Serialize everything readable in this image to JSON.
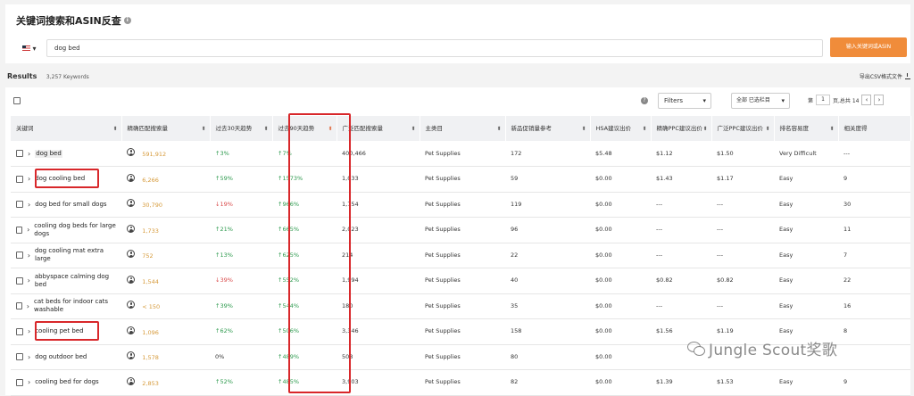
{
  "header": {
    "title": "关键词搜索和ASIN反查",
    "search_value": "dog bed",
    "search_button": "输入关键词或ASIN"
  },
  "results": {
    "label": "Results",
    "count": "3,257 Keywords",
    "export": "导出CSV格式文件"
  },
  "toolbar": {
    "filters": "Filters",
    "column_select": "全部 已选栏目",
    "page_prefix": "第",
    "page_value": "1",
    "page_suffix": "页,总共 14"
  },
  "columns": [
    "关键词",
    "精确匹配搜索量",
    "过去30天趋势",
    "过去90天趋势",
    "广泛匹配搜索量",
    "主类目",
    "新品促销量参考",
    "HSA建议出价",
    "精确PPC建议出价",
    "广泛PPC建议出价",
    "排名容易度",
    "相关度得"
  ],
  "rows": [
    {
      "keyword": "dog bed",
      "exact": "591,912",
      "t30": "3%",
      "t30dir": "up",
      "t90": "7%",
      "broad": "400,466",
      "category": "Pet Supplies",
      "promo": "172",
      "hsa": "$5.48",
      "exact_ppc": "$1.12",
      "broad_ppc": "$1.50",
      "ease": "Very Difficult",
      "rel": "---"
    },
    {
      "keyword": "dog cooling bed",
      "exact": "6,266",
      "t30": "59%",
      "t30dir": "up",
      "t90": "1573%",
      "broad": "1,033",
      "category": "Pet Supplies",
      "promo": "59",
      "hsa": "$0.00",
      "exact_ppc": "$1.43",
      "broad_ppc": "$1.17",
      "ease": "Easy",
      "rel": "9"
    },
    {
      "keyword": "dog bed for small dogs",
      "exact": "30,790",
      "t30": "19%",
      "t30dir": "down",
      "t90": "966%",
      "broad": "1,754",
      "category": "Pet Supplies",
      "promo": "119",
      "hsa": "$0.00",
      "exact_ppc": "---",
      "broad_ppc": "---",
      "ease": "Easy",
      "rel": "30"
    },
    {
      "keyword": "cooling dog beds for large dogs",
      "exact": "1,733",
      "t30": "21%",
      "t30dir": "up",
      "t90": "665%",
      "broad": "2,023",
      "category": "Pet Supplies",
      "promo": "96",
      "hsa": "$0.00",
      "exact_ppc": "---",
      "broad_ppc": "---",
      "ease": "Easy",
      "rel": "11"
    },
    {
      "keyword": "dog cooling mat extra large",
      "exact": "752",
      "t30": "13%",
      "t30dir": "up",
      "t90": "625%",
      "broad": "214",
      "category": "Pet Supplies",
      "promo": "22",
      "hsa": "$0.00",
      "exact_ppc": "---",
      "broad_ppc": "---",
      "ease": "Easy",
      "rel": "7"
    },
    {
      "keyword": "abbyspace calming dog bed",
      "exact": "1,544",
      "t30": "39%",
      "t30dir": "down",
      "t90": "552%",
      "broad": "1,994",
      "category": "Pet Supplies",
      "promo": "40",
      "hsa": "$0.00",
      "exact_ppc": "$0.82",
      "broad_ppc": "$0.82",
      "ease": "Easy",
      "rel": "22"
    },
    {
      "keyword": "cat beds for indoor cats washable",
      "exact": "< 150",
      "t30": "39%",
      "t30dir": "up",
      "t90": "544%",
      "broad": "180",
      "category": "Pet Supplies",
      "promo": "35",
      "hsa": "$0.00",
      "exact_ppc": "---",
      "broad_ppc": "---",
      "ease": "Easy",
      "rel": "16"
    },
    {
      "keyword": "cooling pet bed",
      "exact": "1,096",
      "t30": "62%",
      "t30dir": "up",
      "t90": "506%",
      "broad": "3,346",
      "category": "Pet Supplies",
      "promo": "158",
      "hsa": "$0.00",
      "exact_ppc": "$1.56",
      "broad_ppc": "$1.19",
      "ease": "Easy",
      "rel": "8"
    },
    {
      "keyword": "dog outdoor bed",
      "exact": "1,578",
      "t30": "0%",
      "t30dir": "flat",
      "t90": "489%",
      "broad": "508",
      "category": "Pet Supplies",
      "promo": "80",
      "hsa": "$0.00",
      "exact_ppc": "",
      "broad_ppc": "",
      "ease": "",
      "rel": ""
    },
    {
      "keyword": "cooling bed for dogs",
      "exact": "2,853",
      "t30": "52%",
      "t30dir": "up",
      "t90": "485%",
      "broad": "3,903",
      "category": "Pet Supplies",
      "promo": "82",
      "hsa": "$0.00",
      "exact_ppc": "$1.39",
      "broad_ppc": "$1.53",
      "ease": "Easy",
      "rel": "9"
    }
  ],
  "watermark": "Jungle Scout奖歌",
  "icons": {
    "up_arrow": "↑",
    "down_arrow": "↓",
    "sort": "⬍",
    "chevron": "›"
  }
}
